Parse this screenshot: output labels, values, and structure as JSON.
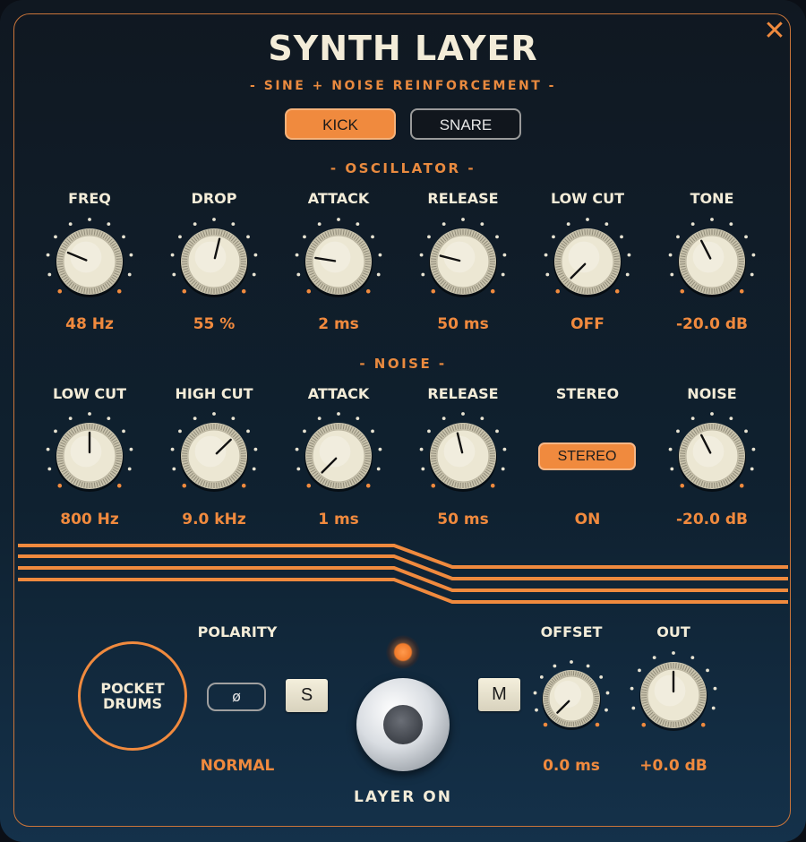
{
  "header": {
    "title": "SYNTH LAYER",
    "subtitle": "- SINE + NOISE REINFORCEMENT -",
    "close_icon": "close-icon"
  },
  "tabs": [
    {
      "label": "KICK",
      "active": true
    },
    {
      "label": "SNARE",
      "active": false
    }
  ],
  "oscillator": {
    "section_label": "- OSCILLATOR -",
    "controls": [
      {
        "label": "FREQ",
        "value": "48 Hz",
        "level": 0.25
      },
      {
        "label": "DROP",
        "value": "55 %",
        "level": 0.55
      },
      {
        "label": "ATTACK",
        "value": "2 ms",
        "level": 0.2
      },
      {
        "label": "RELEASE",
        "value": "50 ms",
        "level": 0.22
      },
      {
        "label": "LOW CUT",
        "value": "OFF",
        "level": 0.0
      },
      {
        "label": "TONE",
        "value": "-20.0 dB",
        "level": 0.4
      }
    ]
  },
  "noise": {
    "section_label": "- NOISE -",
    "controls": [
      {
        "label": "LOW CUT",
        "value": "800 Hz",
        "level": 0.5
      },
      {
        "label": "HIGH CUT",
        "value": "9.0 kHz",
        "level": 0.67
      },
      {
        "label": "ATTACK",
        "value": "1 ms",
        "level": 0.0
      },
      {
        "label": "RELEASE",
        "value": "50 ms",
        "level": 0.45
      },
      {
        "label": "STEREO",
        "value": "ON",
        "button_label": "STEREO"
      },
      {
        "label": "NOISE",
        "value": "-20.0 dB",
        "level": 0.4
      }
    ]
  },
  "bottom": {
    "logo_line1": "POCKET",
    "logo_line2": "DRUMS",
    "polarity_label": "POLARITY",
    "polarity_button": "ø",
    "polarity_value": "NORMAL",
    "solo_button": "S",
    "mute_button": "M",
    "layer_on_label": "LAYER ON",
    "offset": {
      "label": "OFFSET",
      "value": "0.0 ms",
      "level": 0.0
    },
    "out": {
      "label": "OUT",
      "value": "+0.0 dB",
      "level": 0.5
    }
  },
  "colors": {
    "accent": "#f08a3e",
    "cream": "#f3ecd8",
    "background": "#101821"
  }
}
